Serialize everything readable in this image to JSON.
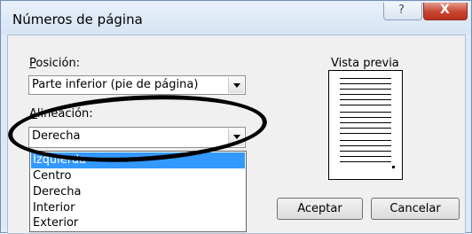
{
  "dialog": {
    "title": "Números de página",
    "help_label": "?",
    "close_label": "X"
  },
  "position": {
    "label_mnemonic": "P",
    "label_rest": "osición:",
    "value": "Parte inferior (pie de página)"
  },
  "alignment": {
    "label_mnemonic": "A",
    "label_rest": "lineación:",
    "value": "Derecha",
    "options": [
      "Izquierda",
      "Centro",
      "Derecha",
      "Interior",
      "Exterior"
    ],
    "selected_index": 0
  },
  "preview": {
    "label": "Vista previa"
  },
  "buttons": {
    "ok": "Aceptar",
    "cancel": "Cancelar"
  }
}
